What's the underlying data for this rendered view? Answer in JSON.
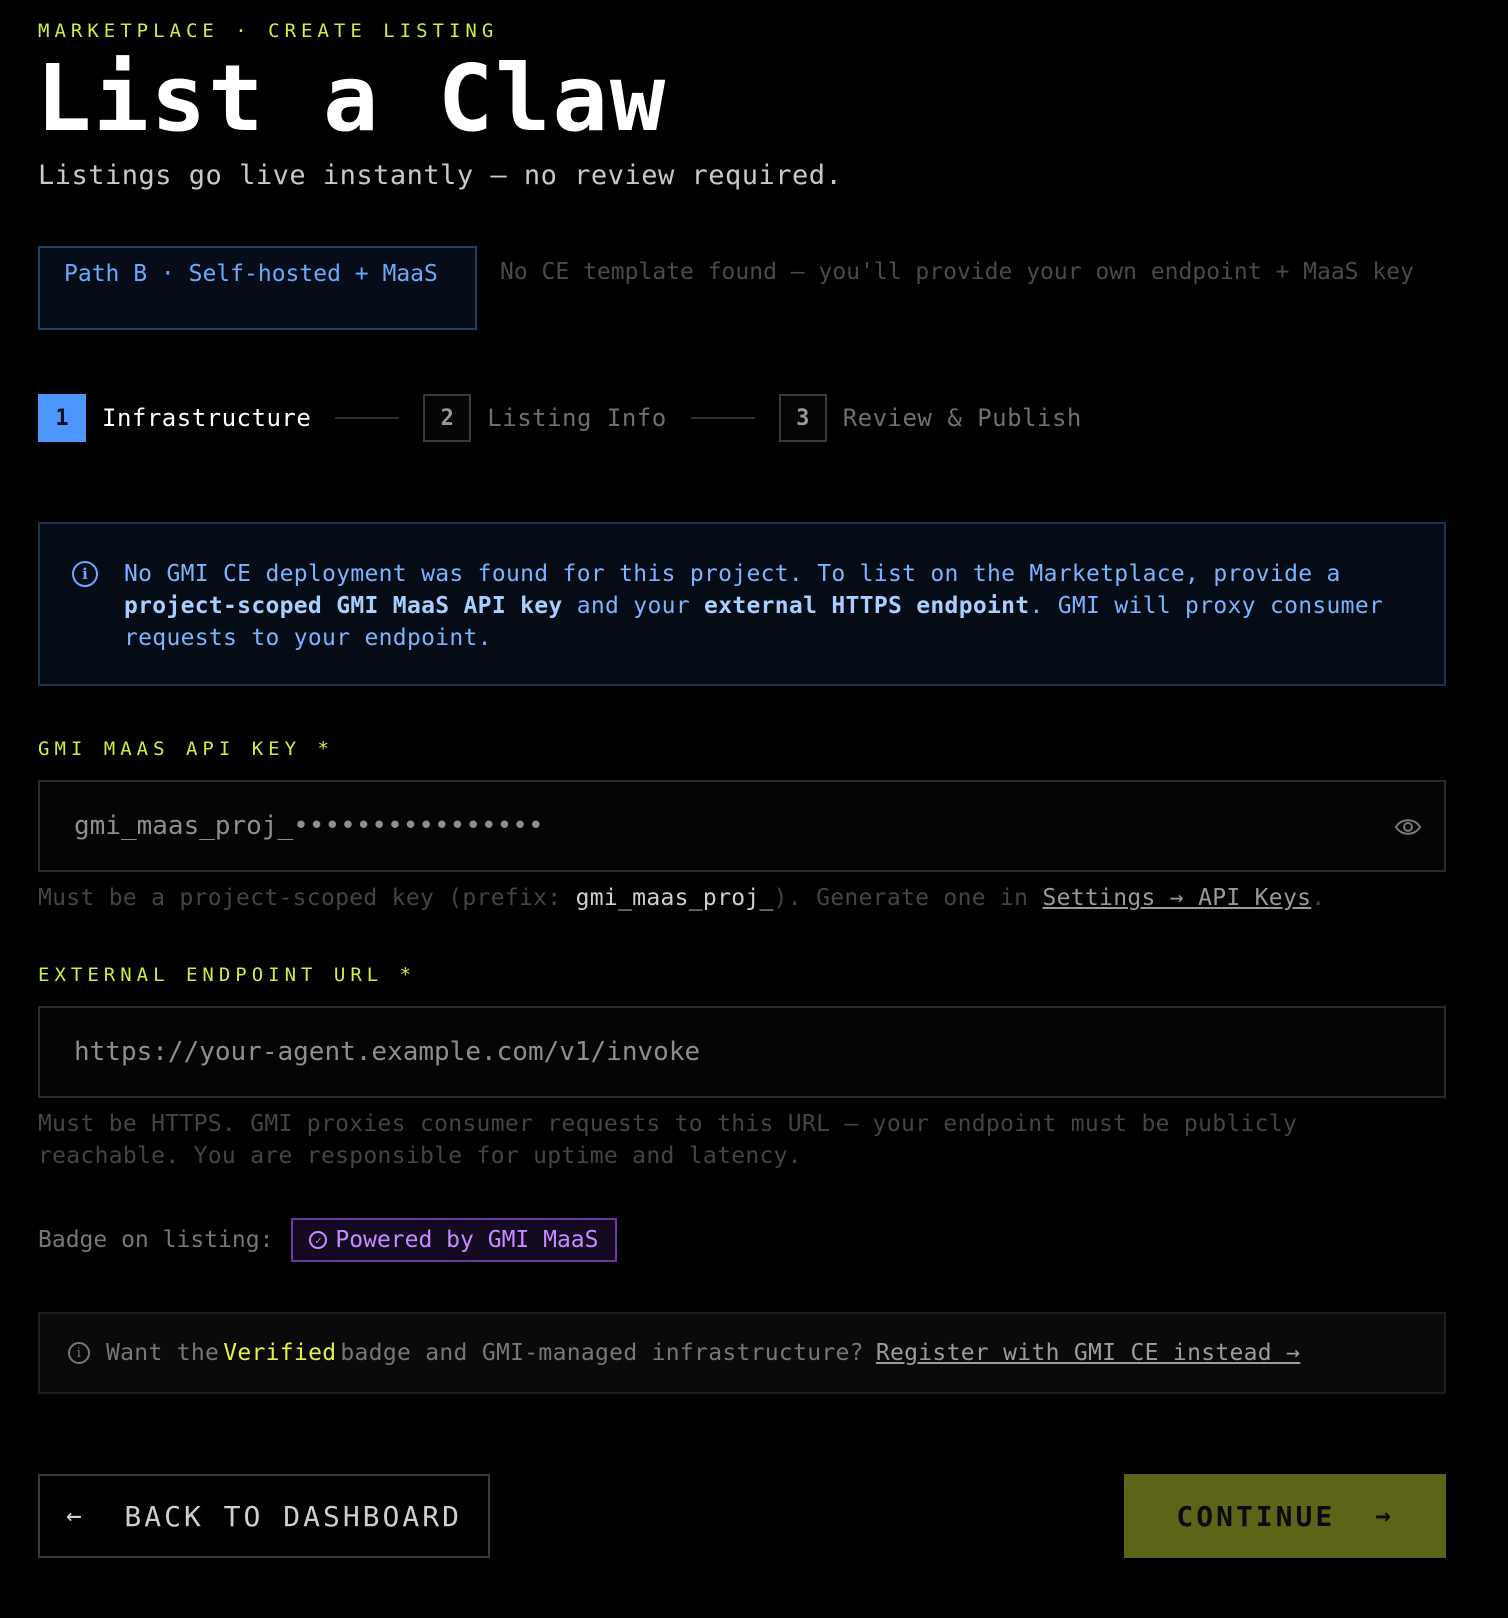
{
  "header": {
    "eyebrow": "MARKETPLACE · CREATE LISTING",
    "title": "List a Claw",
    "subtitle": "Listings go live instantly — no review required."
  },
  "path": {
    "label": "Path B · Self-hosted + MaaS",
    "note": "No CE template found — you'll provide your own endpoint + MaaS key"
  },
  "steps": [
    {
      "num": "1",
      "label": "Infrastructure",
      "active": true
    },
    {
      "num": "2",
      "label": "Listing Info",
      "active": false
    },
    {
      "num": "3",
      "label": "Review & Publish",
      "active": false
    }
  ],
  "info": {
    "part1": "No GMI CE deployment was found for this project. To list on the Marketplace, provide a ",
    "bold1": "project-scoped GMI MaaS API key",
    "part2": " and your ",
    "bold2": "external HTTPS endpoint",
    "part3": ". GMI will proxy consumer requests to your endpoint."
  },
  "api_key": {
    "label": "GMI MAAS API KEY *",
    "value": "gmi_maas_proj_••••••••••••••••",
    "hint_prefix": "Must be a project-scoped key (prefix: ",
    "hint_code": "gmi_maas_proj_",
    "hint_mid": "). Generate one in ",
    "hint_link": "Settings → API Keys",
    "hint_end": "."
  },
  "endpoint": {
    "label": "EXTERNAL ENDPOINT URL *",
    "placeholder": "https://your-agent.example.com/v1/invoke",
    "hint": "Must be HTTPS. GMI proxies consumer requests to this URL — your endpoint must be publicly reachable. You are responsible for uptime and latency."
  },
  "badge": {
    "label": "Badge on listing:",
    "text": "Powered by GMI MaaS"
  },
  "promo": {
    "prefix": "Want the",
    "highlight": "Verified",
    "suffix": "badge and GMI-managed infrastructure?",
    "link": "Register with GMI CE instead →"
  },
  "actions": {
    "back": "BACK TO DASHBOARD",
    "continue": "CONTINUE"
  },
  "colors": {
    "accent_yellow": "#d6ea3f",
    "accent_blue": "#4d96ff",
    "badge_purple": "#c58cff",
    "continue_bg": "#5c6418"
  }
}
